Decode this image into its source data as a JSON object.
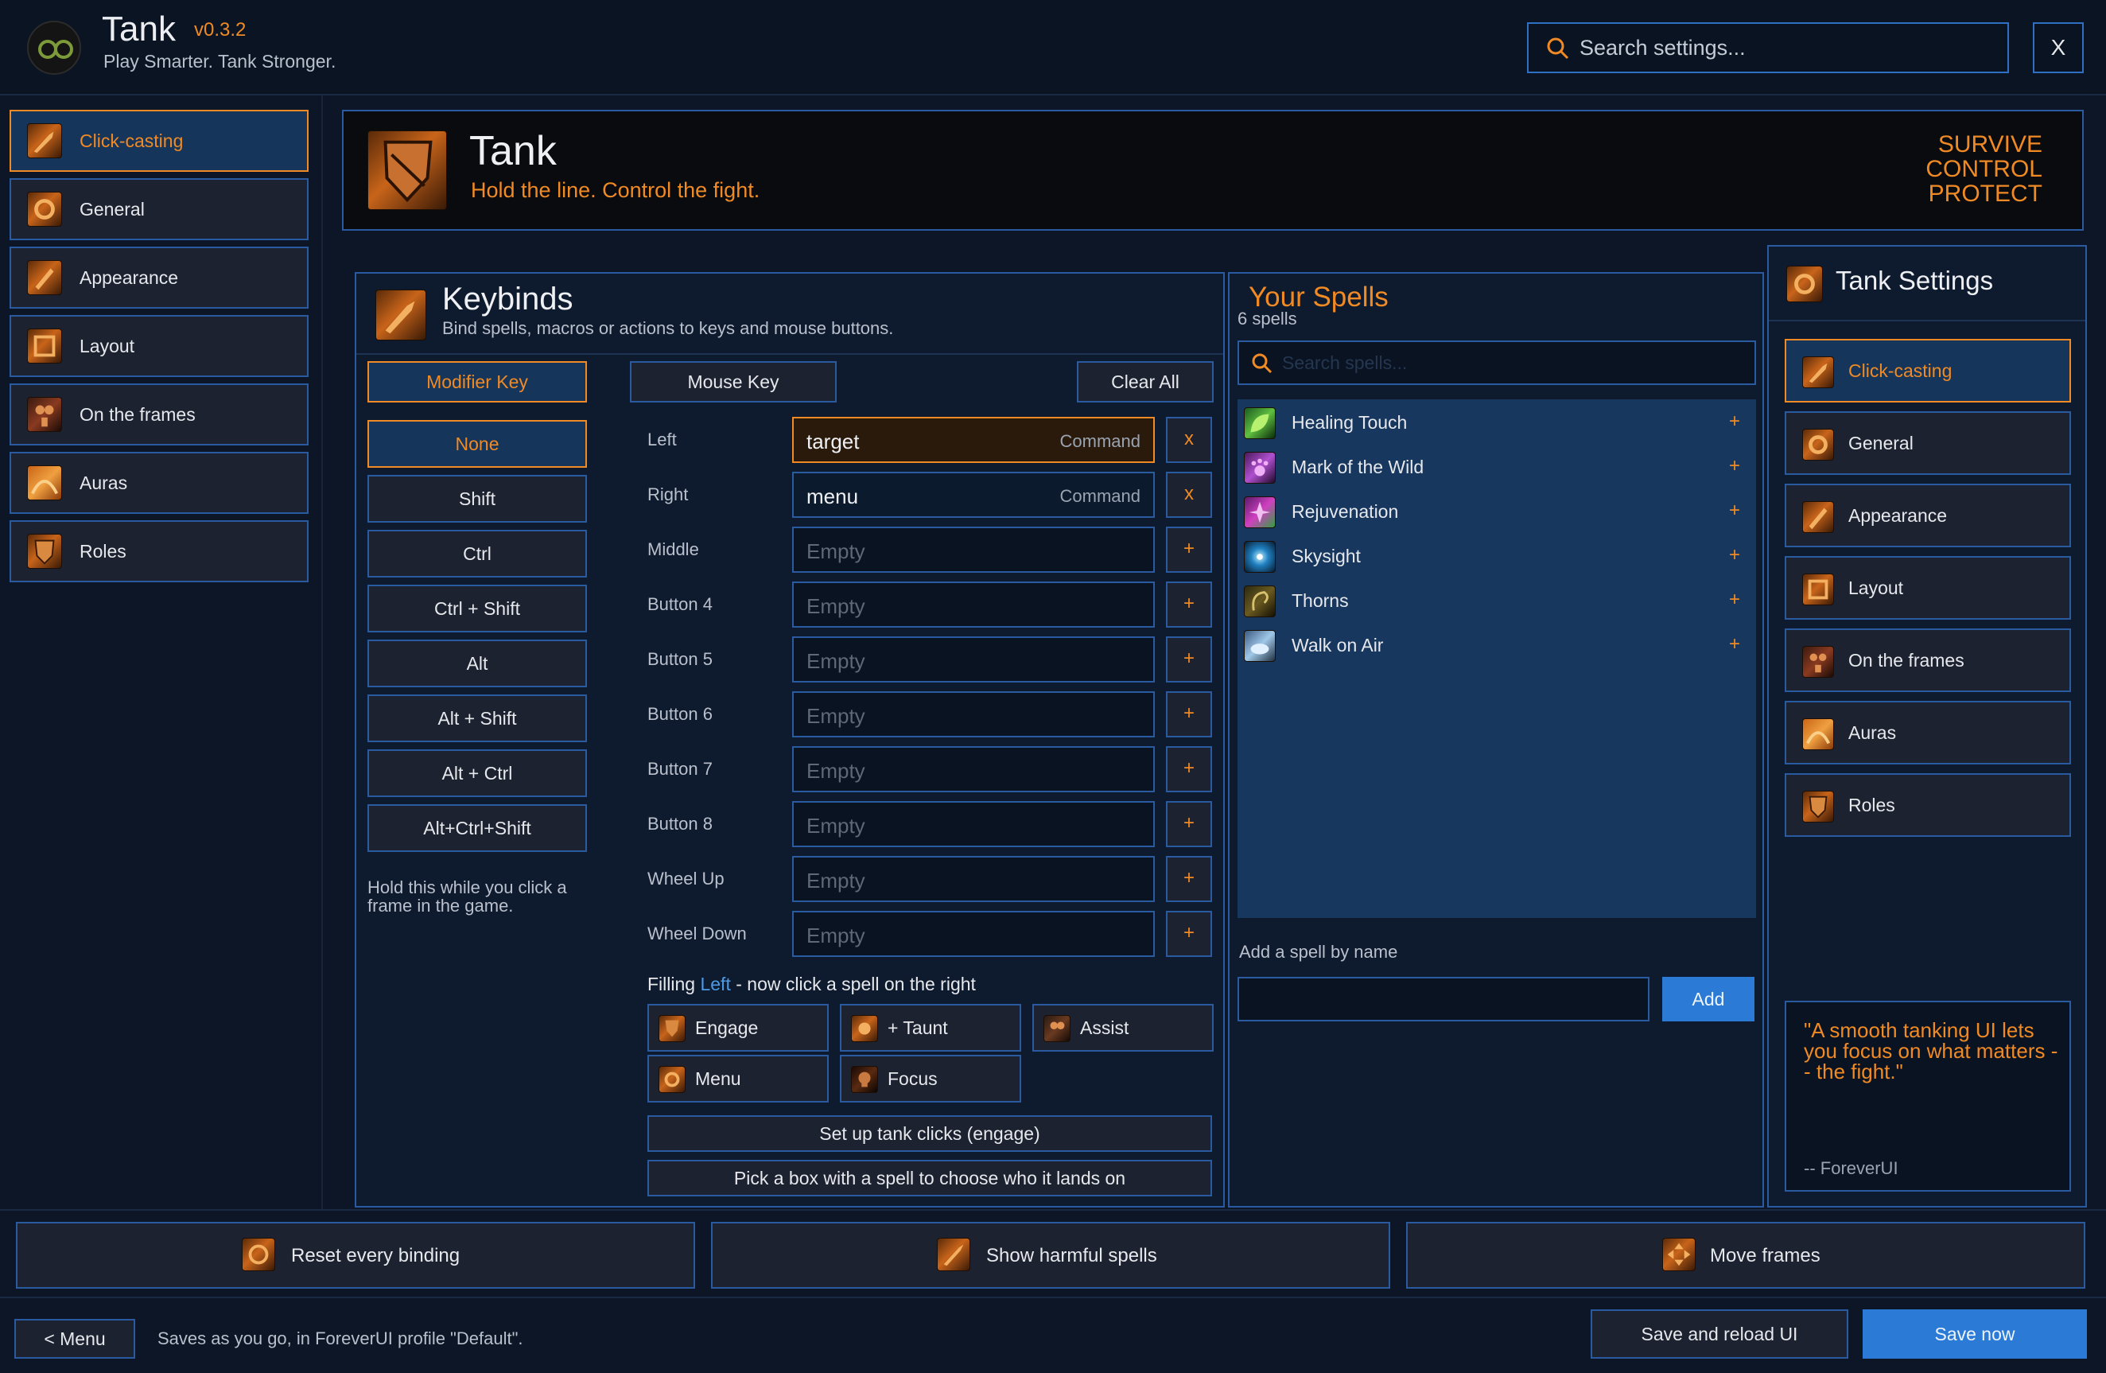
{
  "app": {
    "title": "Tank",
    "version": "v0.3.2",
    "tagline": "Play Smarter. Tank Stronger.",
    "search_placeholder": "Search settings...",
    "close_label": "X"
  },
  "nav": {
    "items": [
      {
        "label": "Click-casting",
        "icon": "wrench-icon",
        "active": true
      },
      {
        "label": "General",
        "icon": "gear-icon",
        "active": false
      },
      {
        "label": "Appearance",
        "icon": "brush-icon",
        "active": false
      },
      {
        "label": "Layout",
        "icon": "layout-icon",
        "active": false
      },
      {
        "label": "On the frames",
        "icon": "group-icon",
        "active": false
      },
      {
        "label": "Auras",
        "icon": "aura-icon",
        "active": false
      },
      {
        "label": "Roles",
        "icon": "shield-icon",
        "active": false
      }
    ]
  },
  "banner": {
    "title": "Tank",
    "subtitle": "Hold the line. Control the fight.",
    "motto": [
      "SURVIVE",
      "CONTROL",
      "PROTECT"
    ]
  },
  "keybinds": {
    "title": "Keybinds",
    "subtitle": "Bind spells, macros or actions to keys and mouse buttons.",
    "tabs": {
      "modifier": "Modifier Key",
      "mouse": "Mouse Key",
      "clear": "Clear All"
    },
    "modifiers": [
      "None",
      "Shift",
      "Ctrl",
      "Ctrl + Shift",
      "Alt",
      "Alt + Shift",
      "Alt + Ctrl",
      "Alt+Ctrl+Shift"
    ],
    "active_modifier": "None",
    "hold_hint": "Hold this while you click a frame in the game.",
    "bindings": [
      {
        "button": "Left",
        "value": "target",
        "tag": "Command",
        "action": "x"
      },
      {
        "button": "Right",
        "value": "menu",
        "tag": "Command",
        "action": "x"
      },
      {
        "button": "Middle",
        "value": "Empty",
        "tag": "",
        "action": "+"
      },
      {
        "button": "Button 4",
        "value": "Empty",
        "tag": "",
        "action": "+"
      },
      {
        "button": "Button 5",
        "value": "Empty",
        "tag": "",
        "action": "+"
      },
      {
        "button": "Button 6",
        "value": "Empty",
        "tag": "",
        "action": "+"
      },
      {
        "button": "Button 7",
        "value": "Empty",
        "tag": "",
        "action": "+"
      },
      {
        "button": "Button 8",
        "value": "Empty",
        "tag": "",
        "action": "+"
      },
      {
        "button": "Wheel Up",
        "value": "Empty",
        "tag": "",
        "action": "+"
      },
      {
        "button": "Wheel Down",
        "value": "Empty",
        "tag": "",
        "action": "+"
      }
    ],
    "filling": {
      "prefix": "Filling ",
      "target": "Left",
      "suffix": " - now click a spell on the right"
    },
    "quick_actions": [
      "Engage",
      "+ Taunt",
      "Assist",
      "Menu",
      "Focus"
    ],
    "setup_button": "Set up tank clicks (engage)",
    "pick_button": "Pick a box with a spell to choose who it lands on"
  },
  "spells": {
    "title": "Your Spells",
    "count": "6 spells",
    "search_placeholder": "Search spells...",
    "items": [
      {
        "name": "Healing Touch",
        "icon": "leaf-icon"
      },
      {
        "name": "Mark of the Wild",
        "icon": "paw-icon"
      },
      {
        "name": "Rejuvenation",
        "icon": "bloom-icon"
      },
      {
        "name": "Skysight",
        "icon": "star-icon"
      },
      {
        "name": "Thorns",
        "icon": "thorns-icon"
      },
      {
        "name": "Walk on Air",
        "icon": "cloud-icon"
      }
    ],
    "add_label": "Add a spell by name",
    "add_button": "Add"
  },
  "settings": {
    "title": "Tank Settings",
    "items": [
      {
        "label": "Click-casting",
        "active": true
      },
      {
        "label": "General",
        "active": false
      },
      {
        "label": "Appearance",
        "active": false
      },
      {
        "label": "Layout",
        "active": false
      },
      {
        "label": "On the frames",
        "active": false
      },
      {
        "label": "Auras",
        "active": false
      },
      {
        "label": "Roles",
        "active": false
      }
    ],
    "quote": "\"A smooth tanking UI lets you focus on what matters -- the fight.\"",
    "quote_author": "-- ForeverUI"
  },
  "footer": {
    "reset": "Reset every binding",
    "harmful": "Show harmful spells",
    "move": "Move frames",
    "menu": "< Menu",
    "status": "Saves as you go, in ForeverUI profile \"Default\".",
    "save_reload": "Save and reload UI",
    "save_now": "Save now"
  },
  "colors": {
    "accent": "#f08a24",
    "border": "#2a5aa0",
    "primary_button": "#2b7ad6",
    "background": "#0c1626"
  }
}
